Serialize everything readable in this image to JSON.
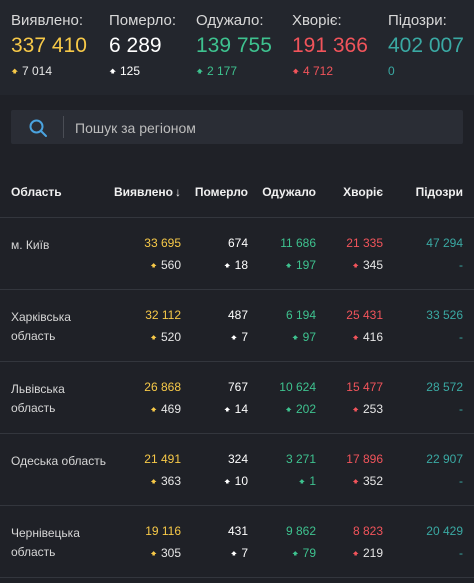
{
  "summary": {
    "confirmed": {
      "label": "Виявлено:",
      "value": "337 410",
      "delta": "7 014"
    },
    "deaths": {
      "label": "Померло:",
      "value": "6 289",
      "delta": "125"
    },
    "recovered": {
      "label": "Одужало:",
      "value": "139 755",
      "delta": "2 177"
    },
    "sick": {
      "label": "Хворіє:",
      "value": "191 366",
      "delta": "4 712"
    },
    "suspected": {
      "label": "Підозри:",
      "value": "402 007",
      "delta": "0"
    }
  },
  "search": {
    "placeholder": "Пошук за регіоном"
  },
  "table": {
    "headers": {
      "region": "Область",
      "confirmed": "Виявлено",
      "deaths": "Померло",
      "recovered": "Одужало",
      "sick": "Хворіє",
      "suspected": "Підозри"
    },
    "rows": [
      {
        "region": "м. Київ",
        "confirmed": "33 695",
        "confirmed_delta": "560",
        "deaths": "674",
        "deaths_delta": "18",
        "recovered": "11 686",
        "recovered_delta": "197",
        "sick": "21 335",
        "sick_delta": "345",
        "suspected": "47 294",
        "suspected_delta": "-"
      },
      {
        "region": "Харківська область",
        "confirmed": "32 112",
        "confirmed_delta": "520",
        "deaths": "487",
        "deaths_delta": "7",
        "recovered": "6 194",
        "recovered_delta": "97",
        "sick": "25 431",
        "sick_delta": "416",
        "suspected": "33 526",
        "suspected_delta": "-"
      },
      {
        "region": "Львівська область",
        "confirmed": "26 868",
        "confirmed_delta": "469",
        "deaths": "767",
        "deaths_delta": "14",
        "recovered": "10 624",
        "recovered_delta": "202",
        "sick": "15 477",
        "sick_delta": "253",
        "suspected": "28 572",
        "suspected_delta": "-"
      },
      {
        "region": "Одеська область",
        "confirmed": "21 491",
        "confirmed_delta": "363",
        "deaths": "324",
        "deaths_delta": "10",
        "recovered": "3 271",
        "recovered_delta": "1",
        "sick": "17 896",
        "sick_delta": "352",
        "suspected": "22 907",
        "suspected_delta": "-"
      },
      {
        "region": "Чернівецька область",
        "confirmed": "19 116",
        "confirmed_delta": "305",
        "deaths": "431",
        "deaths_delta": "7",
        "recovered": "9 862",
        "recovered_delta": "79",
        "sick": "8 823",
        "sick_delta": "219",
        "suspected": "20 429",
        "suspected_delta": "-"
      }
    ]
  },
  "icons": {
    "up": "arrow-up-icon",
    "search": "search-icon",
    "sort": "sort-down-icon"
  },
  "colors": {
    "confirmed": "#f7c948",
    "deaths": "#ffffff",
    "recovered": "#3ec28f",
    "sick": "#f2545b",
    "suspected": "#3aa9a3",
    "background": "#1f2127"
  }
}
